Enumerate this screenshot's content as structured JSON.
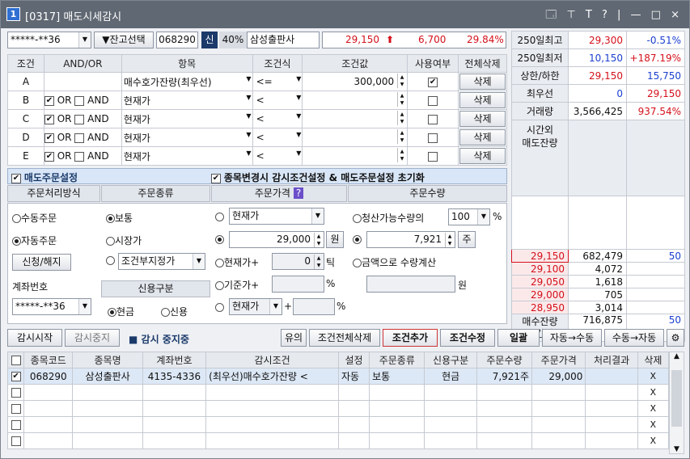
{
  "window": {
    "number": "1",
    "title": "[0317] 매도시세감시",
    "controls": "🗔 ⊤ T ? | — □ ×"
  },
  "top": {
    "account": "*****-**36",
    "balance_select": "▼잔고선택",
    "code": "068290",
    "credit_badge": "신",
    "margin": "40%",
    "stock_name": "삼성출판사",
    "price": "29,150",
    "change": "6,700",
    "change_pct": "29.84%"
  },
  "right_info": [
    {
      "label": "250일최고",
      "value": "29,300",
      "pct": "-0.51%"
    },
    {
      "label": "250일최저",
      "value": "10,150",
      "pct": "+187.19%"
    },
    {
      "label": "상한/하한",
      "value": "29,150",
      "pct": "15,750"
    },
    {
      "label": "최우선",
      "value": "0",
      "pct": "29,150"
    },
    {
      "label": "거래량",
      "value": "3,566,425",
      "pct": "937.54%"
    }
  ],
  "after_hours_label": "시간외\n매도잔량",
  "orderbook": [
    {
      "price": "29,150",
      "qty": "682,479",
      "extra": "50"
    },
    {
      "price": "29,100",
      "qty": "4,072",
      "extra": ""
    },
    {
      "price": "29,050",
      "qty": "1,618",
      "extra": ""
    },
    {
      "price": "29,000",
      "qty": "705",
      "extra": ""
    },
    {
      "price": "28,950",
      "qty": "3,014",
      "extra": ""
    }
  ],
  "bid_total": {
    "label": "매수잔량\n시간외",
    "qty": "716,875",
    "extra": "50"
  },
  "cond_headers": [
    "조건",
    "AND/OR",
    "항목",
    "조건식",
    "조건값",
    "사용여부",
    "전체삭제"
  ],
  "conditions": [
    {
      "id": "A",
      "andor": false,
      "item": "매수호가잔량(최우선)",
      "op": "<=",
      "value": "300,000",
      "use": true,
      "del": "삭제"
    },
    {
      "id": "B",
      "andor": true,
      "item": "현재가",
      "op": "<",
      "value": "",
      "use": false,
      "del": "삭제"
    },
    {
      "id": "C",
      "andor": true,
      "item": "현재가",
      "op": "<",
      "value": "",
      "use": false,
      "del": "삭제"
    },
    {
      "id": "D",
      "andor": true,
      "item": "현재가",
      "op": "<",
      "value": "",
      "use": false,
      "del": "삭제"
    },
    {
      "id": "E",
      "andor": true,
      "item": "현재가",
      "op": "<",
      "value": "",
      "use": false,
      "del": "삭제"
    }
  ],
  "andor_labels": {
    "or": "OR",
    "and": "AND"
  },
  "sell_setting": {
    "label": "매도주문설정",
    "reset_label": "종목변경시 감시조건설정 & 매도주문설정 초기화"
  },
  "sections": {
    "method": "주문처리방식",
    "type": "주문종류",
    "price": "주문가격",
    "qty": "주문수량",
    "credit": "신용구분"
  },
  "method": {
    "manual": "수동주문",
    "auto": "자동주문",
    "apply": "신청/해지",
    "account_label": "계좌번호",
    "account": "*****-**36"
  },
  "order_type": {
    "normal": "보통",
    "market": "시장가",
    "conditional": "조건부지정가"
  },
  "credit": {
    "cash": "현금",
    "credit": "신용"
  },
  "order_price": {
    "opt1": "현재가",
    "value": "29,000",
    "unit": "원",
    "cur_plus": "현재가+",
    "ticks": "0",
    "tick_unit": "틱",
    "base_plus": "기준가+",
    "pct": "%",
    "opt5": "현재가",
    "plus": "+",
    "pct2": "%"
  },
  "order_qty": {
    "sellable": "청산가능수량의",
    "pct": "100",
    "pct_unit": "%",
    "value": "7,921",
    "unit": "주",
    "amount": "금액으로 수량계산",
    "won": "원"
  },
  "actions": {
    "start": "감시시작",
    "stop": "감시중지",
    "status": "감시 중지중",
    "caution": "유의",
    "del_all": "조건전체삭제",
    "add": "조건추가",
    "modify": "조건수정",
    "batch": "일괄",
    "auto_manual": "자동→수동",
    "manual_auto": "수동→자동"
  },
  "list_headers": [
    "",
    "종목코드",
    "종목명",
    "계좌번호",
    "감시조건",
    "설정",
    "주문종류",
    "신용구분",
    "주문수량",
    "주문가격",
    "처리결과",
    "삭제"
  ],
  "list_rows": [
    {
      "checked": true,
      "code": "068290",
      "name": "삼성출판사",
      "account": "4135-4336",
      "cond": "(최우선)매수호가잔량 <",
      "set": "자동",
      "otype": "보통",
      "credit": "현금",
      "qty": "7,921주",
      "price": "29,000",
      "result": "",
      "del": "X"
    },
    {
      "checked": false,
      "code": "",
      "name": "",
      "account": "",
      "cond": "",
      "set": "",
      "otype": "",
      "credit": "",
      "qty": "",
      "price": "",
      "result": "",
      "del": "X"
    },
    {
      "checked": false,
      "code": "",
      "name": "",
      "account": "",
      "cond": "",
      "set": "",
      "otype": "",
      "credit": "",
      "qty": "",
      "price": "",
      "result": "",
      "del": "X"
    },
    {
      "checked": false,
      "code": "",
      "name": "",
      "account": "",
      "cond": "",
      "set": "",
      "otype": "",
      "credit": "",
      "qty": "",
      "price": "",
      "result": "",
      "del": "X"
    },
    {
      "checked": false,
      "code": "",
      "name": "",
      "account": "",
      "cond": "",
      "set": "",
      "otype": "",
      "credit": "",
      "qty": "",
      "price": "",
      "result": "",
      "del": "X"
    }
  ]
}
